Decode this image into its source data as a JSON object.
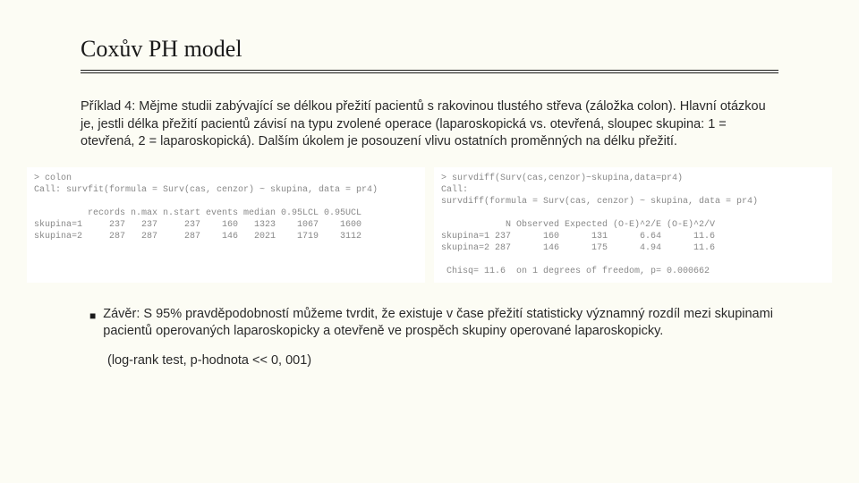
{
  "title": "Coxův PH model",
  "intro": "Příklad 4: Mějme studii zabývající se délkou přežití pacientů s rakovinou tlustého střeva (záložka colon). Hlavní otázkou je, jestli délka přežití pacientů závisí na typu zvolené operace (laparoskopická vs. otevřená, sloupec skupina: 1 = otevřená, 2 = laparoskopická). Dalším úkolem je posouzení vlivu ostatních proměnných na délku přežití.",
  "panel_left": "> colon\nCall: survfit(formula = Surv(cas, cenzor) ~ skupina, data = pr4)\n\n          records n.max n.start events median 0.95LCL 0.95UCL\nskupina=1     237   237     237    160   1323    1067    1600\nskupina=2     287   287     287    146   2021    1719    3112",
  "panel_right": "> survdiff(Surv(cas,cenzor)~skupina,data=pr4)\nCall:\nsurvdiff(formula = Surv(cas, cenzor) ~ skupina, data = pr4)\n\n            N Observed Expected (O-E)^2/E (O-E)^2/V\nskupina=1 237      160      131      6.64      11.6\nskupina=2 287      146      175      4.94      11.6\n\n Chisq= 11.6  on 1 degrees of freedom, p= 0.000662",
  "bullet": "■",
  "conclusion": "Závěr: S 95% pravděpodobností můžeme tvrdit, že existuje v čase přežití  statisticky významný rozdíl mezi skupinami pacientů operovaných laparoskopicky a otevřeně ve prospěch skupiny operované laparoskopicky.",
  "logrank": "(log-rank test, p-hodnota << 0, 001)"
}
